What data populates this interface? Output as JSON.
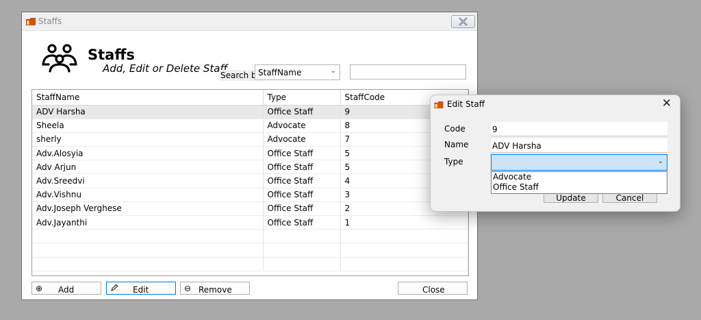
{
  "main_window": {
    "title": "Staffs",
    "header_title": "Staffs",
    "header_subtitle": "Add, Edit or Delete Staff",
    "search_label": "Search by",
    "search_by_selected": "StaffName",
    "search_value": ""
  },
  "grid": {
    "columns": [
      "StaffName",
      "Type",
      "StaffCode"
    ],
    "rows": [
      {
        "name": "ADV Harsha",
        "type": "Office Staff",
        "code": "9"
      },
      {
        "name": "Sheela",
        "type": "Advocate",
        "code": "8"
      },
      {
        "name": "sherly",
        "type": "Advocate",
        "code": "7"
      },
      {
        "name": "Adv.Alosyia",
        "type": "Office Staff",
        "code": "5"
      },
      {
        "name": "Adv Arjun",
        "type": "Office Staff",
        "code": "5"
      },
      {
        "name": "Adv.Sreedvi",
        "type": "Office Staff",
        "code": "4"
      },
      {
        "name": "Adv.Vishnu",
        "type": "Office Staff",
        "code": "3"
      },
      {
        "name": "Adv.Joseph Verghese",
        "type": "Office Staff",
        "code": "2"
      },
      {
        "name": "Adv.Jayanthi",
        "type": "Office Staff",
        "code": "1"
      }
    ]
  },
  "buttons": {
    "add": "Add",
    "edit": "Edit",
    "remove": "Remove",
    "close": "Close"
  },
  "edit_dialog": {
    "title": "Edit Staff",
    "code_label": "Code",
    "code_value": "9",
    "name_label": "Name",
    "name_value": "ADV Harsha",
    "type_label": "Type",
    "type_value": "",
    "type_options": [
      "Advocate",
      "Office Staff"
    ],
    "update_label": "Update",
    "cancel_label": "Cancel"
  },
  "icons": {
    "app": "app-icon",
    "header": "people-group-icon",
    "add": "plus-circle-icon",
    "edit": "pencil-icon",
    "remove": "minus-circle-icon"
  }
}
